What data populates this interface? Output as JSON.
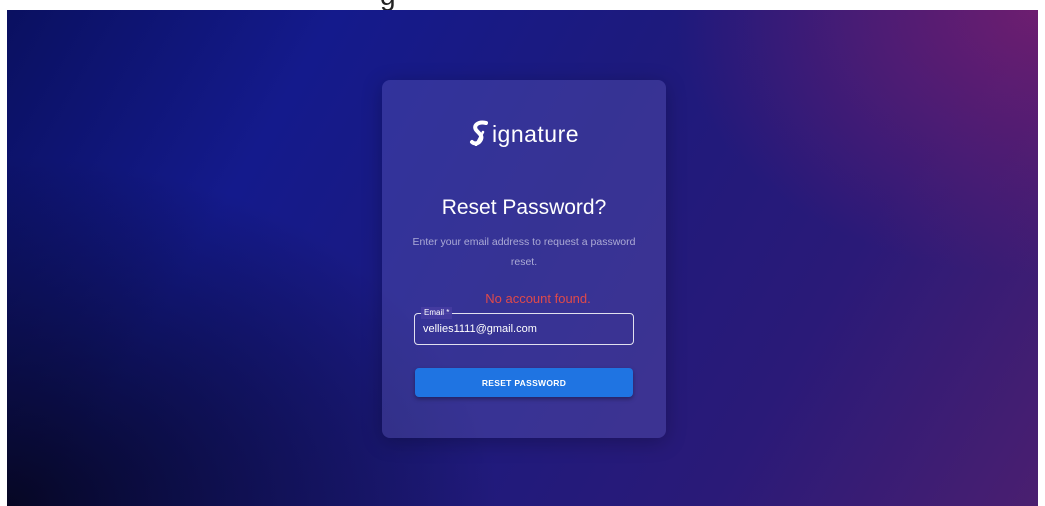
{
  "header": {
    "cut_off_text": "g"
  },
  "brand": {
    "name": "ignature",
    "logo_icon": "signature-s-icon"
  },
  "form": {
    "title": "Reset Password?",
    "subtitle": "Enter your email address to request a password reset.",
    "error": "No account found.",
    "email_label": "Email *",
    "email_value": "vellies1111@gmail.com",
    "submit_label": "RESET PASSWORD"
  },
  "colors": {
    "button": "#1f74e2",
    "error": "#e04a4a",
    "background_start": "#0a1060",
    "background_end": "#4a1f70"
  }
}
